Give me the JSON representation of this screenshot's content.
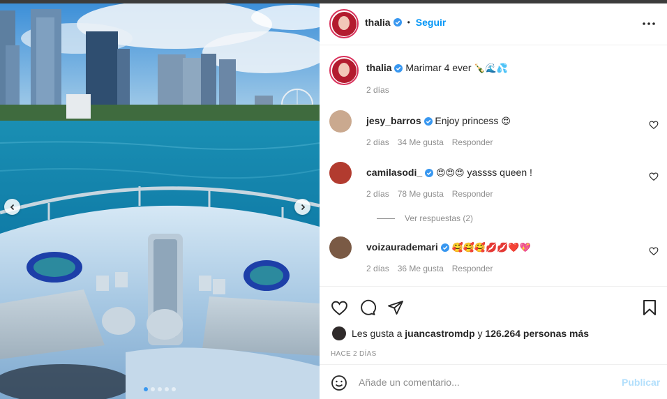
{
  "post": {
    "author": "thalia",
    "follow_label": "Seguir",
    "separator": "•",
    "caption": {
      "user": "thalia",
      "text": "Marimar 4 ever",
      "emojis": "🍾🌊💦",
      "time": "2 días"
    }
  },
  "comments": [
    {
      "user": "jesy_barros",
      "verified": true,
      "text": "Enjoy princess",
      "emojis": "😍",
      "time": "2 días",
      "likes": "34 Me gusta",
      "reply_label": "Responder"
    },
    {
      "user": "camilasodi_",
      "verified": true,
      "text": "yassss queen !",
      "emojis": "😍😍😍",
      "time": "2 días",
      "likes": "78 Me gusta",
      "reply_label": "Responder",
      "view_replies": "Ver respuestas (2)"
    },
    {
      "user": "voizaurademari",
      "verified": true,
      "text": "",
      "emojis": "🥰🥰🥰💋💋❤️💖",
      "time": "2 días",
      "likes": "36 Me gusta",
      "reply_label": "Responder"
    }
  ],
  "likes": {
    "prefix": "Les gusta a",
    "user": "juancastromdp",
    "connector": "y",
    "count": "126.264 personas más"
  },
  "timestamp": "HACE 2 DÍAS",
  "composer": {
    "placeholder": "Añade un comentario...",
    "publish_label": "Publicar"
  },
  "carousel": {
    "slides": 5,
    "active": 1
  },
  "colors": {
    "accent": "#0095f6",
    "verified": "#3897f0",
    "publish_disabled": "#b2dffc",
    "muted": "#8e8e8e"
  }
}
